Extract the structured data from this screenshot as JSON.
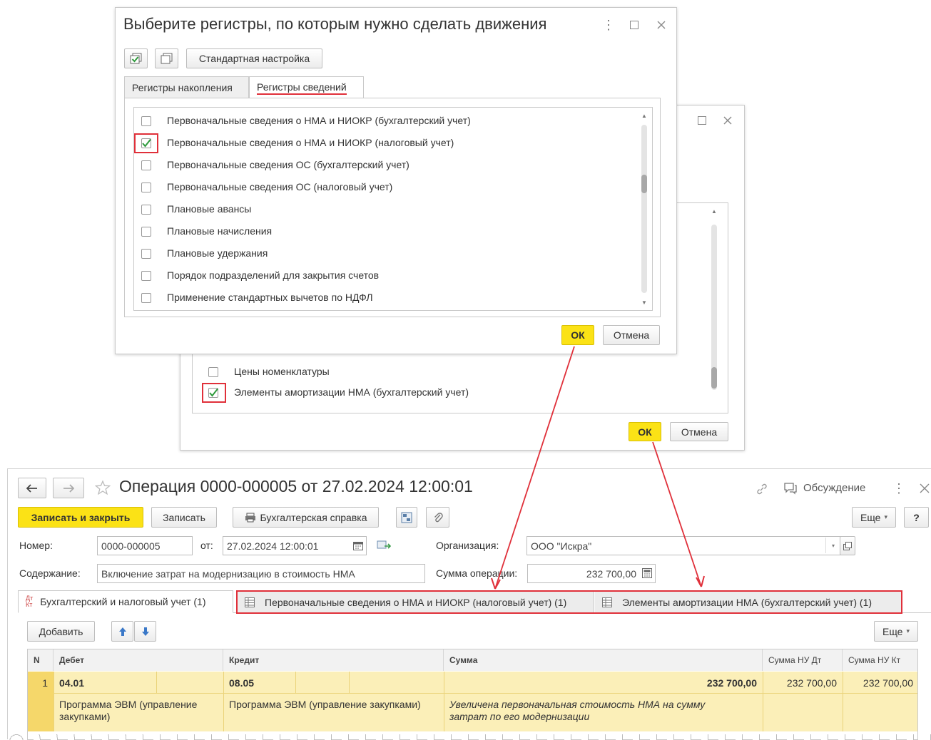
{
  "back_dialog": {
    "list_items": [
      {
        "label": "Цены номенклатуры",
        "checked": false
      },
      {
        "label": "Элементы амортизации НМА (бухгалтерский учет)",
        "checked": true
      }
    ],
    "ok_label": "ОК",
    "cancel_label": "Отмена"
  },
  "front_dialog": {
    "title": "Выберите регистры, по которым нужно сделать движения",
    "std_settings_label": "Стандартная настройка",
    "tabs": [
      "Регистры накопления",
      "Регистры сведений"
    ],
    "items": [
      {
        "label": "Первоначальные сведения о НМА и НИОКР (бухгалтерский учет)",
        "checked": false
      },
      {
        "label": "Первоначальные сведения о НМА и НИОКР (налоговый учет)",
        "checked": true
      },
      {
        "label": "Первоначальные сведения ОС (бухгалтерский учет)",
        "checked": false
      },
      {
        "label": "Первоначальные сведения ОС (налоговый учет)",
        "checked": false
      },
      {
        "label": "Плановые авансы",
        "checked": false
      },
      {
        "label": "Плановые начисления",
        "checked": false
      },
      {
        "label": "Плановые удержания",
        "checked": false
      },
      {
        "label": "Порядок подразделений для закрытия счетов",
        "checked": false
      },
      {
        "label": "Применение стандартных вычетов по НДФЛ",
        "checked": false
      }
    ],
    "ok_label": "ОК",
    "cancel_label": "Отмена"
  },
  "doc": {
    "title": "Операция 0000-000005 от 27.02.2024 12:00:01",
    "discussion_label": "Обсуждение",
    "save_close_label": "Записать и закрыть",
    "save_label": "Записать",
    "report_label": "Бухгалтерская справка",
    "more_label": "Еще",
    "help_label": "?",
    "number_label": "Номер:",
    "number_value": "0000-000005",
    "date_label": "от:",
    "date_value": "27.02.2024 12:00:01",
    "org_label": "Организация:",
    "org_value": "ООО \"Искра\"",
    "content_label": "Содержание:",
    "content_value": "Включение затрат на модернизацию в стоимость НМА",
    "sum_label": "Сумма операции:",
    "sum_value": "232 700,00",
    "tabs": [
      "Бухгалтерский и налоговый учет (1)",
      "Первоначальные сведения о НМА и НИОКР (налоговый учет) (1)",
      "Элементы амортизации НМА (бухгалтерский учет) (1)"
    ],
    "add_label": "Добавить",
    "table_more_label": "Еще",
    "columns": [
      "N",
      "Дебет",
      "Кредит",
      "Сумма",
      "Сумма НУ Дт",
      "Сумма НУ Кт"
    ],
    "row": {
      "n": "1",
      "debit_account": "04.01",
      "debit_subconto": "Программа ЭВМ (управление закупками)",
      "credit_account": "08.05",
      "credit_subconto": "Программа ЭВМ (управление закупками)",
      "sum": "232 700,00",
      "comment": "Увеличена первоначальная стоимость НМА на сумму затрат по его модернизации",
      "sum_nu_dt": "232 700,00",
      "sum_nu_kt": "232 700,00"
    }
  },
  "colors": {
    "accent_yellow": "#fbe216",
    "highlight_red": "#e0303a",
    "row_yellow": "#fbefb8"
  }
}
